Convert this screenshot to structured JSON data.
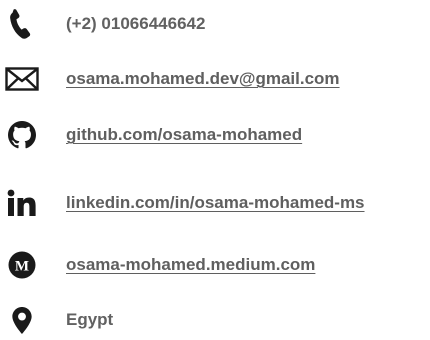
{
  "contacts": {
    "phone": {
      "icon": "phone-icon",
      "text": "(+2) 01066446642"
    },
    "email": {
      "icon": "envelope-icon",
      "text": "osama.mohamed.dev@gmail.com"
    },
    "github": {
      "icon": "github-icon",
      "text": "github.com/osama-mohamed"
    },
    "linkedin": {
      "icon": "linkedin-icon",
      "text": "linkedin.com/in/osama-mohamed-ms"
    },
    "medium": {
      "icon": "medium-icon",
      "text": "osama-mohamed.medium.com"
    },
    "location": {
      "icon": "map-marker-icon",
      "text": "Egypt"
    }
  },
  "colors": {
    "icon": "#1a1a1a",
    "text": "#616161"
  }
}
